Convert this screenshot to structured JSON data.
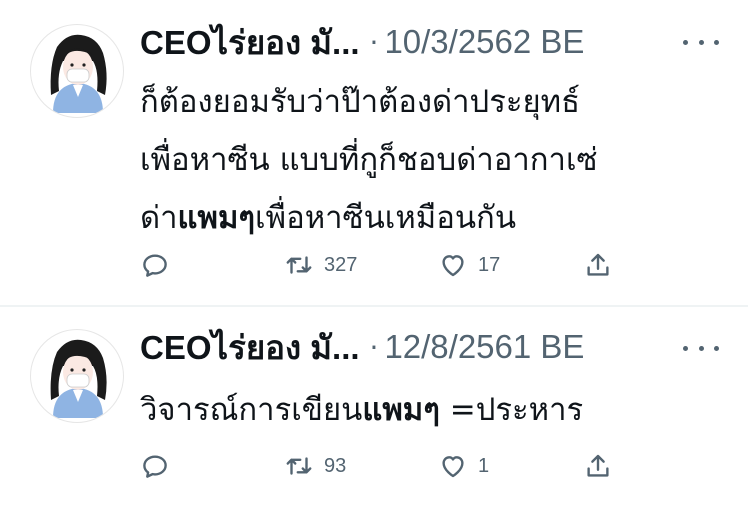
{
  "tweets": [
    {
      "author": "CEOไร่ยอง มั...",
      "separator": "·",
      "date": "10/3/2562 BE",
      "text_lines": [
        [
          "ก็ต้องยอมรับว่าป๊าต้องด่าประยุทธ์"
        ],
        [
          "เพื่อหาซีน แบบที่กูก็ชอบด่าอากาเซ่"
        ],
        [
          "ด่า",
          "แพมๆ",
          "เพื่อหาซีนเหมือนกัน"
        ]
      ],
      "line1": "ก็ต้องยอมรับว่าป๊าต้องด่าประยุทธ์",
      "line2": "เพื่อหาซีน แบบที่กูก็ชอบด่าอากาเซ่",
      "line3_a": "ด่า",
      "line3_b": "แพมๆ",
      "line3_c": "เพื่อหาซีนเหมือนกัน",
      "retweets": "327",
      "likes": "17"
    },
    {
      "author": "CEOไร่ยอง มั...",
      "separator": "·",
      "date": "12/8/2561 BE",
      "line1_a": "วิจารณ์การเขียน",
      "line1_b": "แพมๆ",
      "line1_c": " =ประหาร",
      "retweets": "93",
      "likes": "1"
    }
  ],
  "colors": {
    "text": "#0f1419",
    "secondary": "#536471",
    "divider": "#eff3f4",
    "avatar_shirt": "#8fb4e3",
    "avatar_hair": "#1b1b1b"
  },
  "icons": [
    "reply-icon",
    "retweet-icon",
    "like-icon",
    "share-icon",
    "more-icon",
    "avatar-illustration"
  ]
}
